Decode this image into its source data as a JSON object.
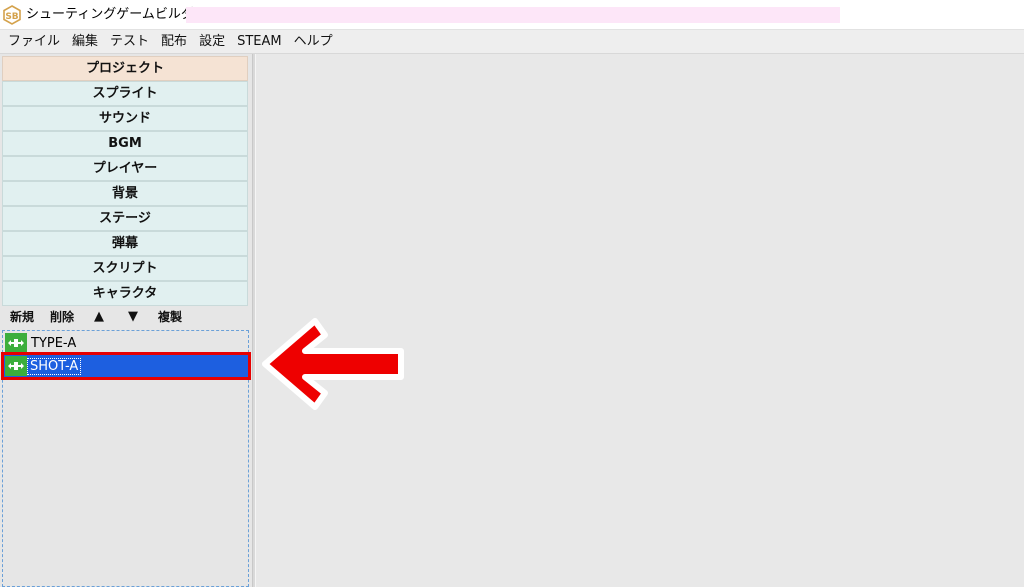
{
  "window": {
    "title": "シューティングゲームビルダー"
  },
  "menu": {
    "items": [
      "ファイル",
      "編集",
      "テスト",
      "配布",
      "設定",
      "STEAM",
      "ヘルプ"
    ]
  },
  "categories": [
    {
      "label": "プロジェクト",
      "active": true
    },
    {
      "label": "スプライト",
      "active": false
    },
    {
      "label": "サウンド",
      "active": false
    },
    {
      "label": "BGM",
      "active": false
    },
    {
      "label": "プレイヤー",
      "active": false
    },
    {
      "label": "背景",
      "active": false
    },
    {
      "label": "ステージ",
      "active": false
    },
    {
      "label": "弾幕",
      "active": false
    },
    {
      "label": "スクリプト",
      "active": false
    },
    {
      "label": "キャラクタ",
      "active": false
    }
  ],
  "toolbar": {
    "new_label": "新規",
    "delete_label": "削除",
    "up_label": "▲",
    "down_label": "▼",
    "duplicate_label": "複製"
  },
  "list": {
    "items": [
      {
        "label": "TYPE-A",
        "icon": "ship-icon",
        "selected": false
      },
      {
        "label": "SHOT-A",
        "icon": "ship-icon",
        "selected": true
      }
    ]
  },
  "colors": {
    "selection": "#1d5fe0",
    "highlight_outline": "#e60000",
    "item_icon": "#3cae3c",
    "active_category": "#f5e3d4",
    "category": "#e1f0f0"
  }
}
